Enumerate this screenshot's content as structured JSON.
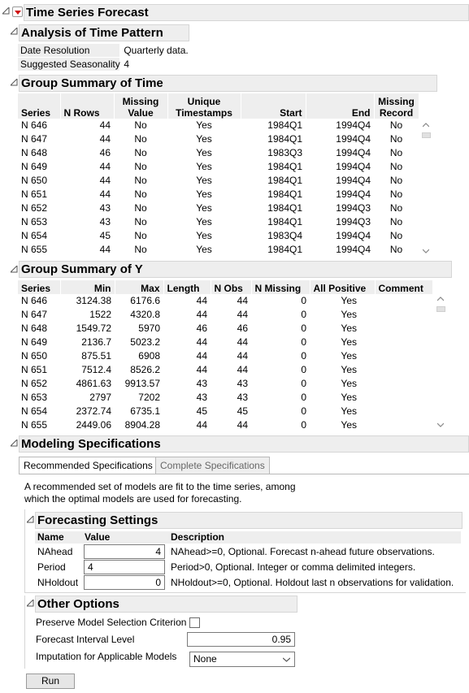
{
  "title": "Time Series Forecast",
  "analysis": {
    "heading": "Analysis of Time Pattern",
    "rows": [
      {
        "label": "Date Resolution",
        "value": "Quarterly data."
      },
      {
        "label": "Suggested Seasonality",
        "value": "4"
      }
    ]
  },
  "group_time": {
    "heading": "Group Summary of Time",
    "columns": [
      "Series",
      "N Rows",
      "Missing Value",
      "Unique Timestamps",
      "Start",
      "End",
      "Missing Record"
    ],
    "rows": [
      [
        "N 646",
        "44",
        "No",
        "Yes",
        "1984Q1",
        "1994Q4",
        "No"
      ],
      [
        "N 647",
        "44",
        "No",
        "Yes",
        "1984Q1",
        "1994Q4",
        "No"
      ],
      [
        "N 648",
        "46",
        "No",
        "Yes",
        "1983Q3",
        "1994Q4",
        "No"
      ],
      [
        "N 649",
        "44",
        "No",
        "Yes",
        "1984Q1",
        "1994Q4",
        "No"
      ],
      [
        "N 650",
        "44",
        "No",
        "Yes",
        "1984Q1",
        "1994Q4",
        "No"
      ],
      [
        "N 651",
        "44",
        "No",
        "Yes",
        "1984Q1",
        "1994Q4",
        "No"
      ],
      [
        "N 652",
        "43",
        "No",
        "Yes",
        "1984Q1",
        "1994Q3",
        "No"
      ],
      [
        "N 653",
        "43",
        "No",
        "Yes",
        "1984Q1",
        "1994Q3",
        "No"
      ],
      [
        "N 654",
        "45",
        "No",
        "Yes",
        "1983Q4",
        "1994Q4",
        "No"
      ],
      [
        "N 655",
        "44",
        "No",
        "Yes",
        "1984Q1",
        "1994Q4",
        "No"
      ]
    ]
  },
  "group_y": {
    "heading": "Group Summary of Y",
    "columns": [
      "Series",
      "Min",
      "Max",
      "Length",
      "N Obs",
      "N Missing",
      "All Positive",
      "Comment"
    ],
    "rows": [
      [
        "N 646",
        "3124.38",
        "6176.6",
        "44",
        "44",
        "0",
        "Yes",
        ""
      ],
      [
        "N 647",
        "1522",
        "4320.8",
        "44",
        "44",
        "0",
        "Yes",
        ""
      ],
      [
        "N 648",
        "1549.72",
        "5970",
        "46",
        "46",
        "0",
        "Yes",
        ""
      ],
      [
        "N 649",
        "2136.7",
        "5023.2",
        "44",
        "44",
        "0",
        "Yes",
        ""
      ],
      [
        "N 650",
        "875.51",
        "6908",
        "44",
        "44",
        "0",
        "Yes",
        ""
      ],
      [
        "N 651",
        "7512.4",
        "8526.2",
        "44",
        "44",
        "0",
        "Yes",
        ""
      ],
      [
        "N 652",
        "4861.63",
        "9913.57",
        "43",
        "43",
        "0",
        "Yes",
        ""
      ],
      [
        "N 653",
        "2797",
        "7202",
        "43",
        "43",
        "0",
        "Yes",
        ""
      ],
      [
        "N 654",
        "2372.74",
        "6735.1",
        "45",
        "45",
        "0",
        "Yes",
        ""
      ],
      [
        "N 655",
        "2449.06",
        "8904.28",
        "44",
        "44",
        "0",
        "Yes",
        ""
      ]
    ]
  },
  "modeling": {
    "heading": "Modeling Specifications",
    "tabs": [
      "Recommended Specifications",
      "Complete Specifications"
    ],
    "description_line1": "A recommended set of models are fit to the time series, among",
    "description_line2": "which the optimal models are used for forecasting.",
    "forecasting": {
      "heading": "Forecasting Settings",
      "columns": [
        "Name",
        "Value",
        "Description"
      ],
      "rows": [
        {
          "name": "NAhead",
          "value": "4",
          "description": "NAhead>=0, Optional. Forecast n-ahead future observations."
        },
        {
          "name": "Period",
          "value": "4",
          "description": "Period>0, Optional. Integer or comma delimited integers."
        },
        {
          "name": "NHoldout",
          "value": "0",
          "description": "NHoldout>=0, Optional. Holdout last n observations for validation."
        }
      ]
    },
    "other": {
      "heading": "Other Options",
      "preserve_label": "Preserve Model Selection Criterion",
      "interval_label": "Forecast Interval Level",
      "interval_value": "0.95",
      "imputation_label": "Imputation for Applicable Models",
      "imputation_value": "None"
    },
    "run_label": "Run"
  }
}
